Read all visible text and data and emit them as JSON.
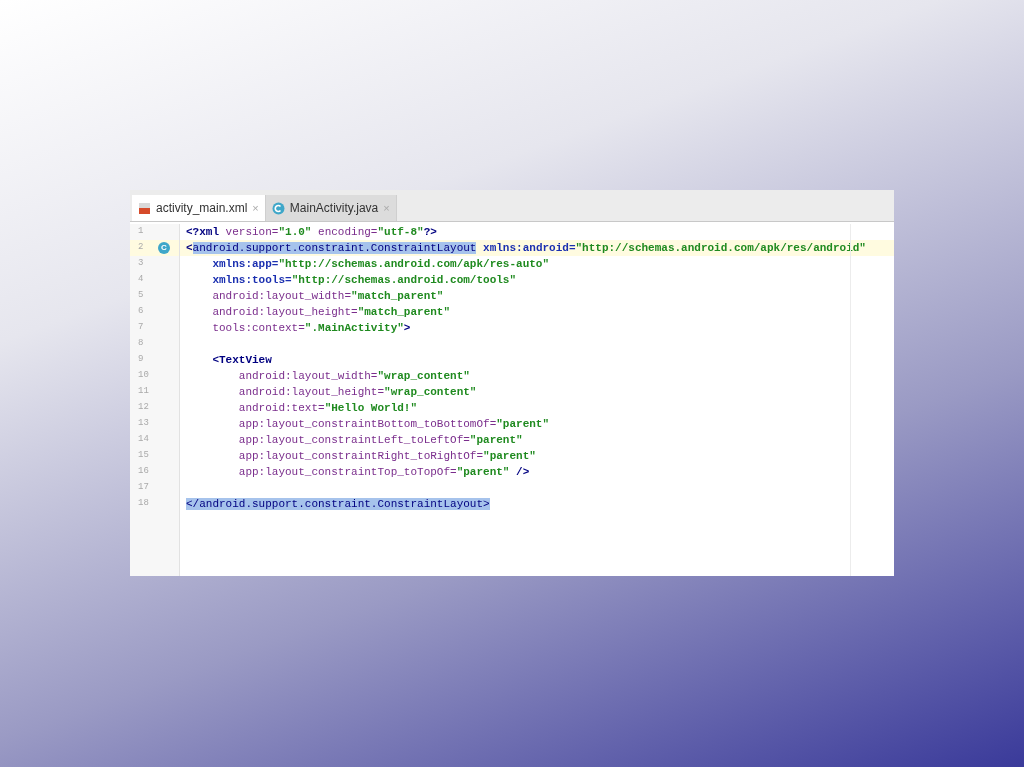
{
  "editor": {
    "tabs": [
      {
        "label": "activity_main.xml",
        "kind": "xml",
        "close": "×",
        "selected": true
      },
      {
        "label": "MainActivity.java",
        "kind": "class",
        "close": "×",
        "selected": false
      }
    ],
    "lines": [
      {
        "number": "1",
        "tokens": [
          {
            "text": "<?xml",
            "kind": "tag"
          },
          {
            "text": " version=",
            "kind": "attr"
          },
          {
            "text": "\"1.0\"",
            "kind": "value"
          },
          {
            "text": " encoding=",
            "kind": "attr"
          },
          {
            "text": "\"utf-8\"",
            "kind": "value"
          },
          {
            "text": "?>",
            "kind": "tag"
          }
        ]
      },
      {
        "number": "2",
        "marker": "C",
        "current": true,
        "tokens": [
          {
            "text": "<",
            "kind": "tag"
          },
          {
            "text": "android.support.constraint.ConstraintLayout",
            "kind": "selection"
          },
          {
            "text": " xmlns:android=",
            "kind": "ns"
          },
          {
            "text": "\"http://schemas.android.com/apk/res/android\"",
            "kind": "value"
          }
        ]
      },
      {
        "number": "3",
        "tokens": [
          {
            "text": "    xmlns:app=",
            "kind": "ns"
          },
          {
            "text": "\"http://schemas.android.com/apk/res-auto\"",
            "kind": "value"
          }
        ]
      },
      {
        "number": "4",
        "tokens": [
          {
            "text": "    xmlns:tools=",
            "kind": "ns"
          },
          {
            "text": "\"http://schemas.android.com/tools\"",
            "kind": "value"
          }
        ]
      },
      {
        "number": "5",
        "tokens": [
          {
            "text": "    android:layout_width=",
            "kind": "attr"
          },
          {
            "text": "\"match_parent\"",
            "kind": "value"
          }
        ]
      },
      {
        "number": "6",
        "tokens": [
          {
            "text": "    android:layout_height=",
            "kind": "attr"
          },
          {
            "text": "\"match_parent\"",
            "kind": "value"
          }
        ]
      },
      {
        "number": "7",
        "tokens": [
          {
            "text": "    tools:context=",
            "kind": "attr"
          },
          {
            "text": "\".MainActivity\"",
            "kind": "value"
          },
          {
            "text": ">",
            "kind": "tag"
          }
        ]
      },
      {
        "number": "8"
      },
      {
        "number": "9",
        "tokens": [
          {
            "text": "    <TextView",
            "kind": "tag"
          }
        ]
      },
      {
        "number": "10",
        "tokens": [
          {
            "text": "        android:layout_width=",
            "kind": "attr"
          },
          {
            "text": "\"wrap_content\"",
            "kind": "value"
          }
        ]
      },
      {
        "number": "11",
        "tokens": [
          {
            "text": "        android:layout_height=",
            "kind": "attr"
          },
          {
            "text": "\"wrap_content\"",
            "kind": "value"
          }
        ]
      },
      {
        "number": "12",
        "tokens": [
          {
            "text": "        android:text=",
            "kind": "attr"
          },
          {
            "text": "\"Hello World!\"",
            "kind": "value"
          }
        ]
      },
      {
        "number": "13",
        "tokens": [
          {
            "text": "        app:layout_constraintBottom_toBottomOf=",
            "kind": "attr"
          },
          {
            "text": "\"parent\"",
            "kind": "value"
          }
        ]
      },
      {
        "number": "14",
        "tokens": [
          {
            "text": "        app:layout_constraintLeft_toLeftOf=",
            "kind": "attr"
          },
          {
            "text": "\"parent\"",
            "kind": "value"
          }
        ]
      },
      {
        "number": "15",
        "tokens": [
          {
            "text": "        app:layout_constraintRight_toRightOf=",
            "kind": "attr"
          },
          {
            "text": "\"parent\"",
            "kind": "value"
          }
        ]
      },
      {
        "number": "16",
        "tokens": [
          {
            "text": "        app:layout_constraintTop_toTopOf=",
            "kind": "attr"
          },
          {
            "text": "\"parent\"",
            "kind": "value"
          },
          {
            "text": " />",
            "kind": "tag"
          }
        ]
      },
      {
        "number": "17"
      },
      {
        "number": "18",
        "tokens": [
          {
            "text": "</android.support.constraint.ConstraintLayout>",
            "kind": "selection"
          }
        ]
      }
    ]
  }
}
